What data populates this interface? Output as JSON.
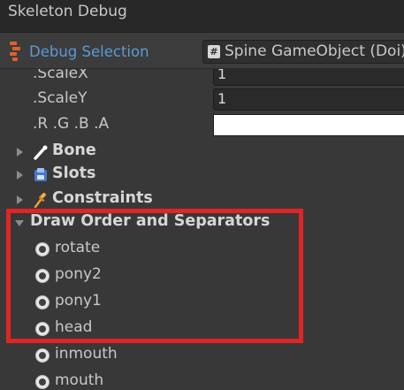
{
  "window": {
    "title": "Skeleton Debug"
  },
  "toolbar": {
    "icon": "debug-selection-icon",
    "label": "Debug Selection",
    "object_field": {
      "icon": "script-hash-icon",
      "hash": "#",
      "value": "Spine GameObject (Doi)"
    }
  },
  "properties": [
    {
      "label": ".ScaleX",
      "value": "1"
    },
    {
      "label": ".ScaleY",
      "value": "1"
    },
    {
      "label": ".R .G .B .A",
      "color": "#ffffff"
    }
  ],
  "sections": [
    {
      "label": "Bone",
      "icon": "bone-icon",
      "expanded": false
    },
    {
      "label": "Slots",
      "icon": "slots-icon",
      "expanded": false
    },
    {
      "label": "Constraints",
      "icon": "pin-icon",
      "expanded": false
    }
  ],
  "draw_order": {
    "label": "Draw Order and Separators",
    "expanded": true,
    "items": [
      "rotate",
      "pony2",
      "pony1",
      "head",
      "inmouth",
      "mouth"
    ]
  },
  "colors": {
    "highlight": "#e02525",
    "accent": "#5a9ad6",
    "background": "#383838"
  }
}
